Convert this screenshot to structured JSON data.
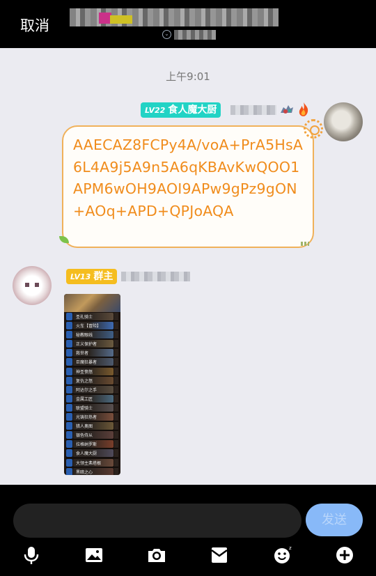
{
  "topbar": {
    "cancel_label": "取消"
  },
  "chat": {
    "timestamp": "上午9:01",
    "messages": [
      {
        "side": "right",
        "badge_level": "LV22",
        "badge_title": "食人魔大厨",
        "text": "AAECAZ8FCPy4A/voA+PrA5HsA6L4A9j5A9n5A6qKBAvKwQOO1APM6wOH9AOI9APw9gPz9gON+AOq+APD+QPJoAQA"
      },
      {
        "side": "left",
        "badge_level": "LV13",
        "badge_title": "群主",
        "image": "deck-screenshot"
      }
    ]
  },
  "deck": {
    "cards": [
      {
        "name": "圣礼骑士",
        "color": "#5b4a3a"
      },
      {
        "name": "火车【冒险】",
        "color": "#3e6bb3"
      },
      {
        "name": "秘教眼线",
        "color": "#3f5f86"
      },
      {
        "name": "正义保护者",
        "color": "#6b5a3f"
      },
      {
        "name": "救世者",
        "color": "#556b8a"
      },
      {
        "name": "巨魔狂暴者",
        "color": "#4d5a6e"
      },
      {
        "name": "神圣愤怒",
        "color": "#7a5a2d"
      },
      {
        "name": "复仇之怒",
        "color": "#6a4b30"
      },
      {
        "name": "阿达尔之手",
        "color": "#5a4e40"
      },
      {
        "name": "金属工匠",
        "color": "#4b6a7f"
      },
      {
        "name": "联盟骑士",
        "color": "#595050"
      },
      {
        "name": "光铸狂热者",
        "color": "#7a4e3b"
      },
      {
        "name": "猎人奥图",
        "color": "#6b5838"
      },
      {
        "name": "银色侍从",
        "color": "#5c3f3a"
      },
      {
        "name": "拉格纳罗斯",
        "color": "#7a3e2a"
      },
      {
        "name": "食人魔大厨",
        "color": "#4f4a5a"
      },
      {
        "name": "大领主弗塔根",
        "color": "#6a4a3a"
      },
      {
        "name": "黑暗之心",
        "color": "#5a3a30"
      }
    ]
  },
  "bottom": {
    "input_placeholder": "",
    "send_label": "发送",
    "tools": [
      "microphone-icon",
      "image-icon",
      "camera-icon",
      "red-packet-icon",
      "emoji-icon",
      "plus-icon"
    ]
  },
  "colors": {
    "bubble_text": "#f08c1c",
    "bubble_border": "#f0b15a",
    "badge_teal": "#22d3c5",
    "badge_gold": "#f5bd1f",
    "send_button": "#88b9f8"
  }
}
